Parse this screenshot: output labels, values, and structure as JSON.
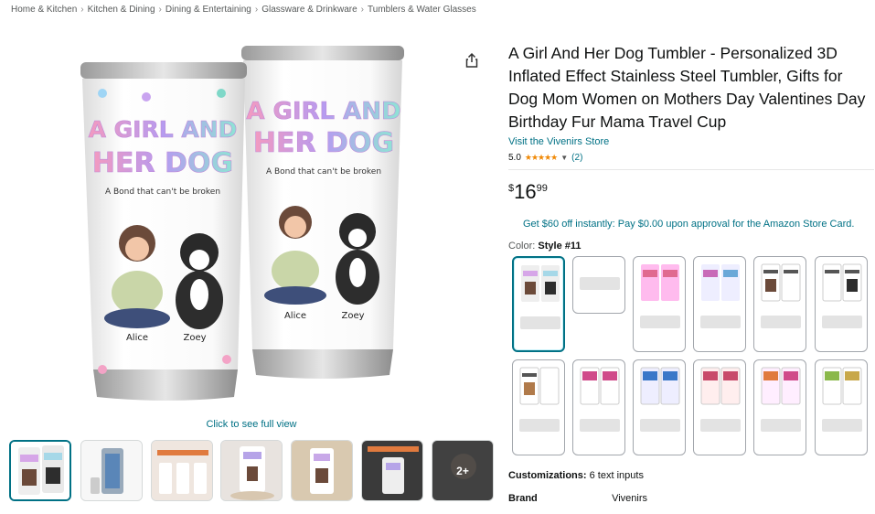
{
  "breadcrumb": [
    "Home & Kitchen",
    "Kitchen & Dining",
    "Dining & Entertaining",
    "Glassware & Drinkware",
    "Tumblers & Water Glasses"
  ],
  "breadcrumb_separator": "›",
  "product": {
    "title": "A Girl And Her Dog Tumbler - Personalized 3D Inflated Effect Stainless Steel Tumbler, Gifts for Dog Mom Women on Mothers Day Valentines Day Birthday Fur Mama Travel Cup",
    "store_link": "Visit the Vivenirs Store",
    "rating": "5.0",
    "stars": "★★★★★",
    "rating_count": "(2)",
    "price_symbol": "$",
    "price_whole": "16",
    "price_fraction": "99",
    "promo": "Get $60 off instantly: Pay $0.00 upon approval for the Amazon Store Card.",
    "color_label": "Color:",
    "color_value": "Style #11",
    "customizations_label": "Customizations:",
    "customizations_value": "6 text inputs",
    "brand_label": "Brand",
    "brand_value": "Vivenirs"
  },
  "gallery": {
    "click_to_view": "Click to see full view",
    "more_label": "2+",
    "tumbler_text_line1": "A GIRL AND",
    "tumbler_text_line2": "HER DOG",
    "tumbler_tagline": "A Bond that can't be broken",
    "name_person": "Alice",
    "name_dog": "Zoey"
  },
  "colors": {
    "accent": "#007185",
    "star": "#f08804",
    "text": "#0f1111",
    "muted": "#565959"
  }
}
